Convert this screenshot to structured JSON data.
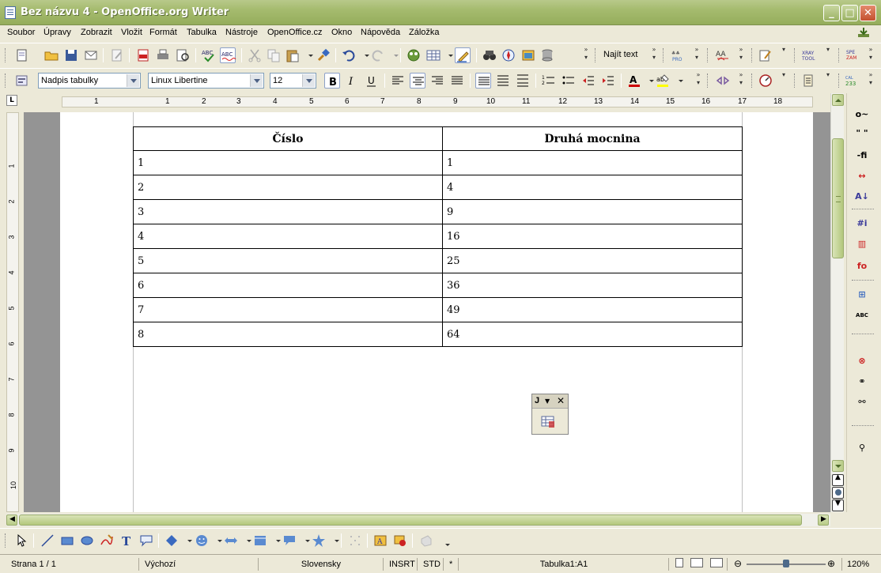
{
  "window": {
    "title": "Bez názvu 4 - OpenOffice.org Writer"
  },
  "menu": [
    "Soubor",
    "Úpravy",
    "Zobrazit",
    "Vložit",
    "Formát",
    "Tabulka",
    "Nástroje",
    "OpenOffice.cz",
    "Okno",
    "Nápověda",
    "Záložka"
  ],
  "toolbar_standard": {
    "find_text_label": "Najít text"
  },
  "toolbar_format": {
    "style": "Nadpis tabulky",
    "font": "Linux Libertine",
    "size": "12"
  },
  "ruler": {
    "h_numbers": [
      "1",
      "1",
      "2",
      "3",
      "4",
      "5",
      "6",
      "7",
      "8",
      "9",
      "10",
      "11",
      "12",
      "13",
      "14",
      "15",
      "16",
      "17",
      "18"
    ],
    "v_numbers": [
      "1",
      "2",
      "3",
      "4",
      "5",
      "6",
      "7",
      "8",
      "9",
      "10"
    ],
    "corner_label": "L"
  },
  "document": {
    "table": {
      "headers": [
        "Číslo",
        "Druhá mocnina"
      ],
      "rows": [
        [
          "1",
          "1"
        ],
        [
          "2",
          "4"
        ],
        [
          "3",
          "9"
        ],
        [
          "4",
          "16"
        ],
        [
          "5",
          "25"
        ],
        [
          "6",
          "36"
        ],
        [
          "7",
          "49"
        ],
        [
          "8",
          "64"
        ]
      ]
    }
  },
  "floating_toolbar": {
    "title": "J"
  },
  "statusbar": {
    "page": "Strana 1 / 1",
    "style": "Výchozí",
    "language": "Slovensky",
    "insert_mode": "INSRT",
    "selection_mode": "STD",
    "modified": "*",
    "cell": "Tabulka1:A1",
    "zoom": "120%"
  },
  "colors": {
    "titlebar": "#a5bb6e",
    "workspace": "#949494"
  }
}
